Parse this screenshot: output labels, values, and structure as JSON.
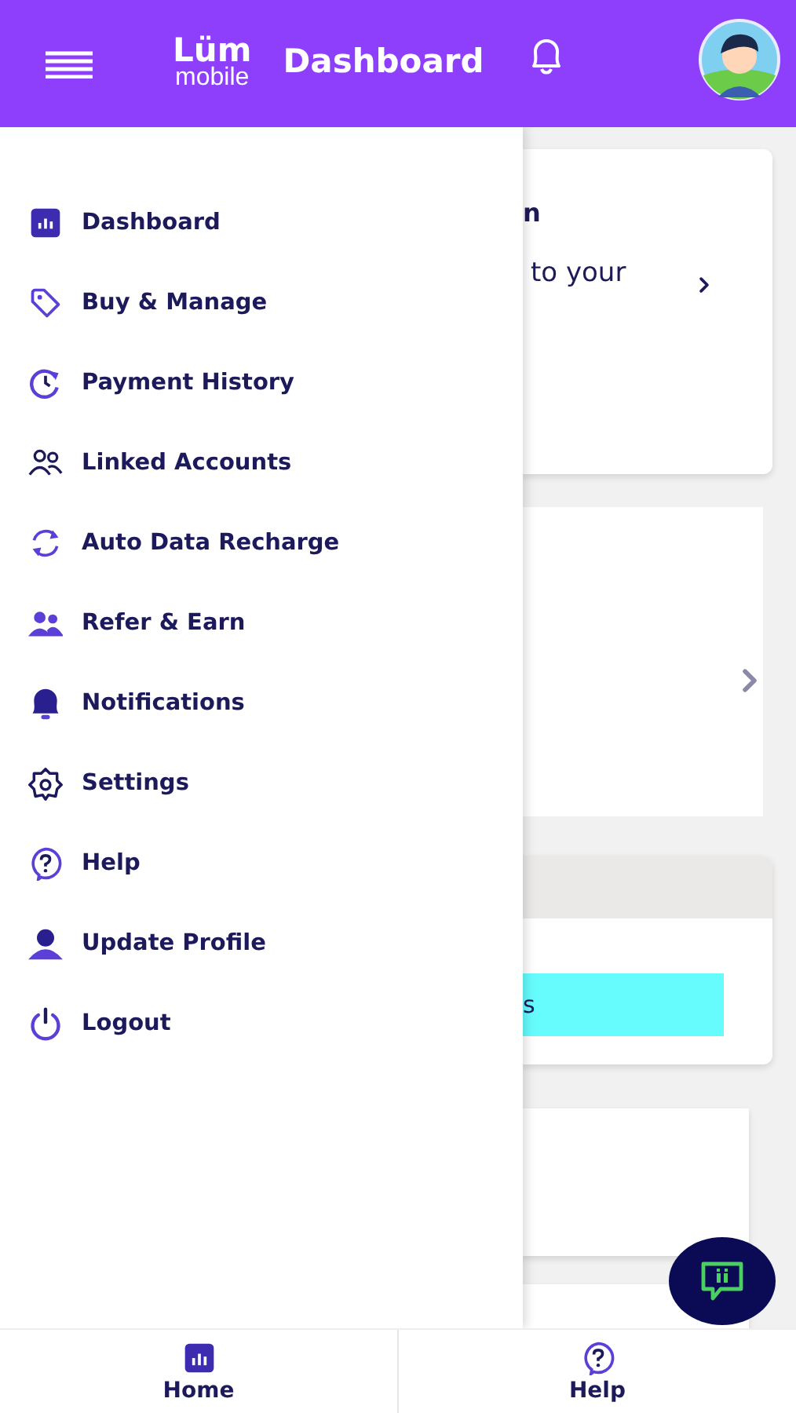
{
  "header": {
    "logo": {
      "word": "Lüm",
      "sub": "mobile"
    },
    "title": "Dashboard"
  },
  "drawer": {
    "items": [
      {
        "label": "Dashboard"
      },
      {
        "label": "Buy & Manage"
      },
      {
        "label": "Payment History"
      },
      {
        "label": "Linked Accounts"
      },
      {
        "label": "Auto Data Recharge"
      },
      {
        "label": "Refer & Earn"
      },
      {
        "label": "Notifications"
      },
      {
        "label": "Settings"
      },
      {
        "label": "Help"
      },
      {
        "label": "Update Profile"
      },
      {
        "label": "Logout"
      }
    ]
  },
  "background_cards": [
    {
      "kind": "link",
      "heading": "n",
      "text": "to your"
    },
    {
      "kind": "link"
    },
    {
      "kind": "action",
      "button": "s"
    },
    {
      "kind": "plain"
    },
    {
      "kind": "plain"
    }
  ],
  "bottom_nav": [
    {
      "label": "Home"
    },
    {
      "label": "Help"
    }
  ]
}
